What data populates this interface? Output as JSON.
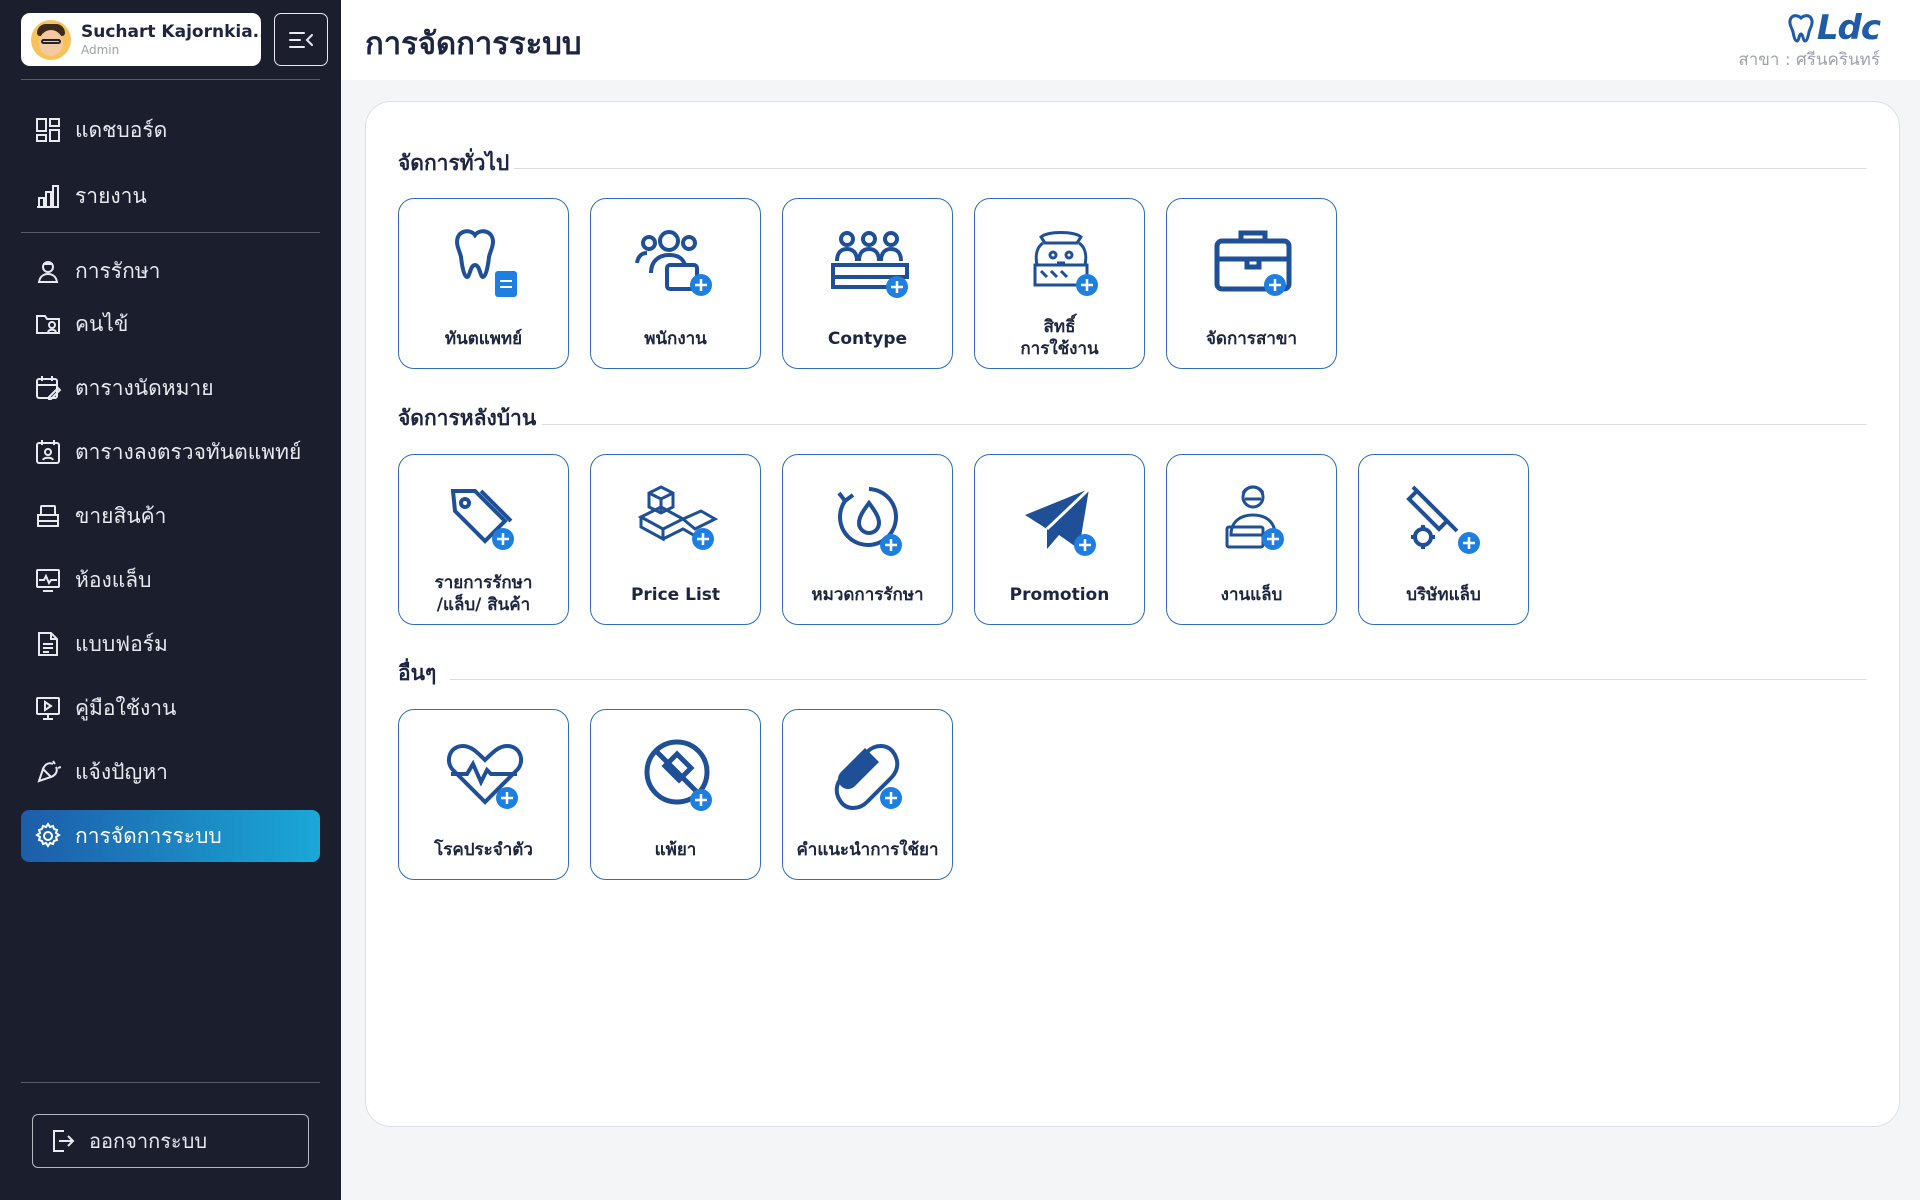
{
  "user": {
    "name": "Suchart Kajornkia...",
    "role": "Admin"
  },
  "nav": [
    {
      "label": "แดชบอร์ด",
      "icon": "dashboard-icon"
    },
    {
      "label": "รายงาน",
      "icon": "report-chart-icon"
    },
    {
      "label": "การรักษา",
      "icon": "doctor-icon"
    },
    {
      "label": "คนไข้",
      "icon": "patient-folder-icon"
    },
    {
      "label": "ตารางนัดหมาย",
      "icon": "calendar-edit-icon"
    },
    {
      "label": "ตารางลงตรวจทันตแพทย์",
      "icon": "calendar-doctor-icon"
    },
    {
      "label": "ขายสินค้า",
      "icon": "cashier-icon"
    },
    {
      "label": "ห้องแล็บ",
      "icon": "lab-monitor-icon"
    },
    {
      "label": "แบบฟอร์ม",
      "icon": "form-document-icon"
    },
    {
      "label": "คู่มือใช้งาน",
      "icon": "manual-screen-icon"
    },
    {
      "label": "แจ้งปัญหา",
      "icon": "report-problem-icon"
    },
    {
      "label": "การจัดการระบบ",
      "icon": "settings-gear-icon"
    }
  ],
  "logout_label": "ออกจากระบบ",
  "header": {
    "title": "การจัดการระบบ",
    "brand": "Ldc",
    "branch": "สาขา : ศรีนครินทร์"
  },
  "sections": [
    {
      "title": "จัดการทั่วไป",
      "cards": [
        {
          "label": "ทันตแพทย์",
          "icon": "tooth-document-icon"
        },
        {
          "label": "พนักงาน",
          "icon": "staff-add-icon"
        },
        {
          "label": "Contype",
          "icon": "group-table-icon"
        },
        {
          "label": "สิทธิ์\nการใช้งาน",
          "icon": "permission-officer-icon"
        },
        {
          "label": "จัดการสาขา",
          "icon": "briefcase-icon"
        }
      ]
    },
    {
      "title": "จัดการหลังบ้าน",
      "cards": [
        {
          "label": "รายการรักษา\n/แล็บ/ สินค้า",
          "icon": "price-tags-icon"
        },
        {
          "label": "Price List",
          "icon": "boxes-icon"
        },
        {
          "label": "หมวดการรักษา",
          "icon": "cycle-drop-icon"
        },
        {
          "label": "Promotion",
          "icon": "paper-plane-icon"
        },
        {
          "label": "งานแล็บ",
          "icon": "lab-worker-icon"
        },
        {
          "label": "บริษัทแล็บ",
          "icon": "syringe-gear-icon"
        }
      ]
    },
    {
      "title": "อื่นๆ",
      "cards": [
        {
          "label": "โรคประจำตัว",
          "icon": "heart-pulse-icon"
        },
        {
          "label": "แพ้ยา",
          "icon": "no-pill-icon"
        },
        {
          "label": "คำแนะนำการใช้ยา",
          "icon": "capsule-icon"
        }
      ]
    }
  ],
  "colors": {
    "sidebar": "#1b1f2d",
    "accent": "#1f5ba6",
    "plus": "#1f7fe0",
    "active_from": "#1d5da9",
    "active_to": "#1aa8d8"
  }
}
